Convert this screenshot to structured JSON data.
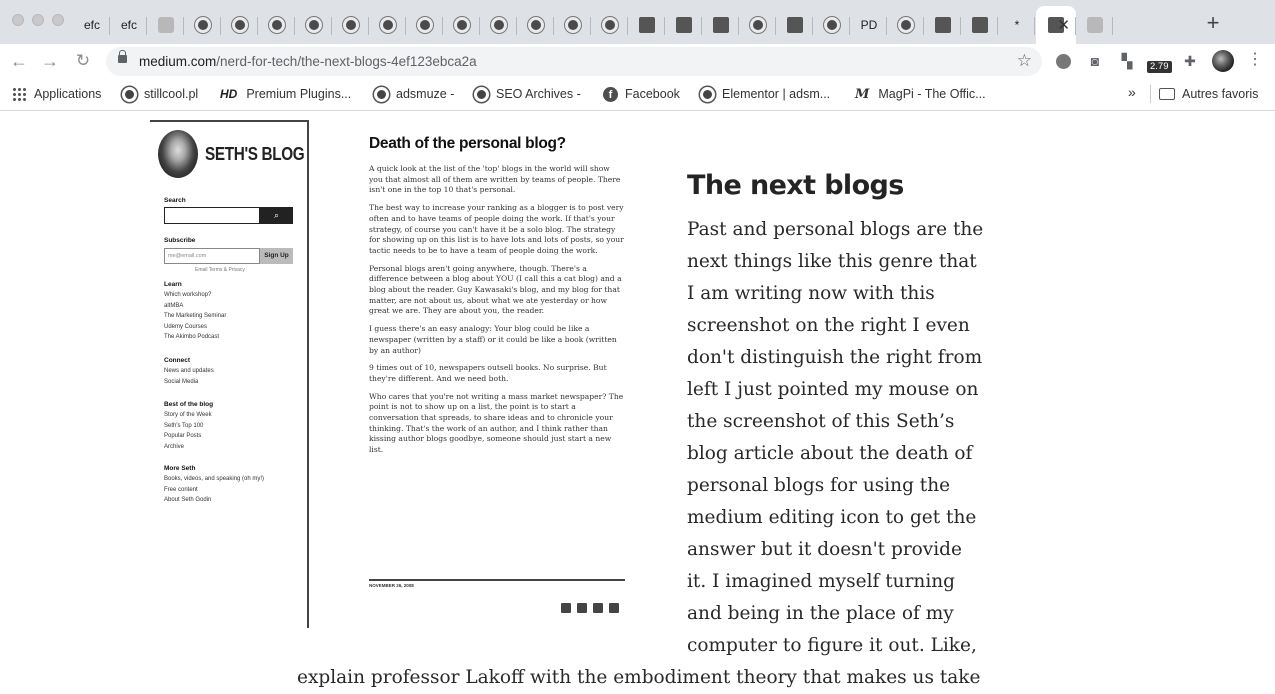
{
  "browser": {
    "tabs": [
      {
        "label": "efc"
      },
      {
        "label": "efc"
      },
      {
        "label": ""
      },
      {
        "label": ""
      },
      {
        "label": ""
      },
      {
        "label": ""
      },
      {
        "label": ""
      },
      {
        "label": ""
      },
      {
        "label": ""
      },
      {
        "label": ""
      },
      {
        "label": ""
      },
      {
        "label": ""
      },
      {
        "label": ""
      },
      {
        "label": ""
      },
      {
        "label": ""
      },
      {
        "label": ""
      },
      {
        "label": ""
      },
      {
        "label": ""
      },
      {
        "label": ""
      },
      {
        "label": ""
      },
      {
        "label": ""
      },
      {
        "label": "PD"
      },
      {
        "label": ""
      },
      {
        "label": ""
      },
      {
        "label": ""
      },
      {
        "label": "*"
      },
      {
        "label": ""
      },
      {
        "label": ""
      }
    ],
    "active_tab_close": "✕",
    "new_tab": "+",
    "url_host": "medium.com",
    "url_path": "/nerd-for-tech/the-next-blogs-4ef123ebca2a",
    "extension_badge": "2.79"
  },
  "bookmarks": [
    {
      "label": "Applications",
      "icon": "grid-icon"
    },
    {
      "label": "stillcool.pl",
      "icon": "globe-icon"
    },
    {
      "label": "Premium Plugins...",
      "icon": "hd-icon",
      "prefix": "HD"
    },
    {
      "label": "adsmuze -",
      "icon": "globe-icon"
    },
    {
      "label": "SEO Archives -",
      "icon": "globe-icon"
    },
    {
      "label": "Facebook",
      "icon": "facebook-icon",
      "prefix": "f"
    },
    {
      "label": "Elementor | adsm...",
      "icon": "globe-icon"
    },
    {
      "label": "MagPi - The Offic...",
      "icon": "magpi-icon",
      "prefix": "M"
    }
  ],
  "bookmarks_overflow": "»",
  "other_bookmarks": "Autres favoris",
  "screenshot": {
    "logo": "SETH'S BLOG",
    "search_label": "Search",
    "subscribe_label": "Subscribe",
    "subscribe_placeholder": "me@email.com",
    "subscribe_button": "Sign Up",
    "terms": "Email Terms & Privacy",
    "sections": [
      {
        "title": "Learn",
        "items": [
          "Which workshop?",
          "altMBA",
          "The Marketing Seminar",
          "Udemy Courses",
          "The Akimbo Podcast"
        ]
      },
      {
        "title": "Connect",
        "items": [
          "News and updates",
          "Social Media"
        ]
      },
      {
        "title": "Best of the blog",
        "items": [
          "Story of the Week",
          "Seth's Top 100",
          "Popular Posts",
          "Archive"
        ]
      },
      {
        "title": "More Seth",
        "items": [
          "Books, videos, and speaking (oh my!)",
          "Free content",
          "About Seth Godin"
        ]
      }
    ],
    "article_title": "Death of the personal blog?",
    "paragraphs": [
      "A quick look at the list of the 'top' blogs in the world will show you that almost all of them are written by teams of people. There isn't one in the top 10 that's personal.",
      "The best way to increase your ranking as a blogger is to post very often and to have teams of people doing the work. If that's your strategy, of course you can't have it be a solo blog. The strategy for showing up on this list is to have lots and lots of posts, so your tactic needs to be to have a team of people doing the work.",
      "Personal blogs aren't going anywhere, though. There's a difference between a blog about YOU (I call this a cat blog) and a blog about the reader. Guy Kawasaki's blog, and my blog for that matter, are not about us, about what we ate yesterday or how great we are. They are about you, the reader.",
      "I guess there's an easy analogy: Your blog could be like a newspaper (written by a staff) or it could be like a book (written by an author)",
      "9 times out of 10, newspapers outsell books. No surprise. But they're different. And we need both.",
      "Who cares that you're not writing a mass market newspaper? The point is not to show up on a list, the point is to start a conversation that spreads, to share ideas and to chronicle your thinking. That's the work of an author, and I think rather than kissing author blogs goodbye, someone should just start a new list."
    ],
    "date": "NOVEMBER 26, 2008"
  },
  "article": {
    "headline": "The next blogs",
    "body": "Past and personal blogs are the next things like this genre that I am writing now with this screenshot on the right I even don't distinguish the right from left I just pointed my mouse on the screenshot of this Seth’s blog article about the death of personal blogs for using the medium editing icon to get the answer but it doesn't provide it. I imagined myself turning and being in the place of my computer to figure it out. Like,",
    "continuation": "explain professor Lakoff with the embodiment theory that makes us take"
  }
}
